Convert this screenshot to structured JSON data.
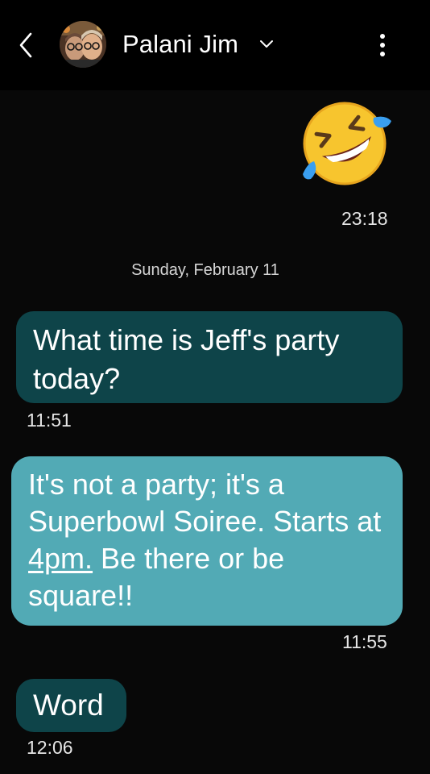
{
  "header": {
    "contact_name": "Palani Jim",
    "back_icon": "chevron-left-icon",
    "dropdown_icon": "chevron-down-icon",
    "menu_icon": "more-vertical-icon"
  },
  "messages": [
    {
      "direction": "outgoing",
      "content": "🤣",
      "time": "23:18"
    },
    {
      "direction": "incoming",
      "text": "What time is Jeff's party today?",
      "time": "11:51"
    },
    {
      "direction": "outgoing",
      "text_before_link": "It's not a party; it's a Superbowl Soiree. Starts at ",
      "link_text": "4pm.",
      "text_after_link": " Be there or be square!!",
      "time": "11:55"
    },
    {
      "direction": "incoming",
      "text": "Word",
      "time": "12:06"
    }
  ],
  "date_separator": "Sunday, February 11",
  "colors": {
    "background": "#080808",
    "incoming_bubble": "#0e4449",
    "outgoing_bubble": "#52aab5",
    "text": "#ffffff"
  }
}
